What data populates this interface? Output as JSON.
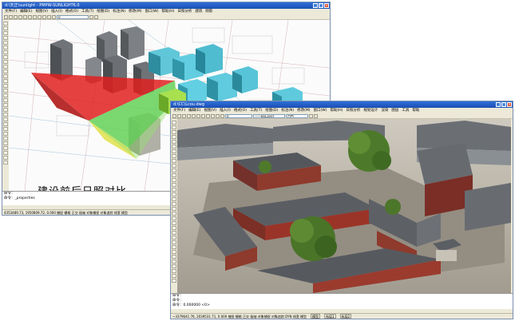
{
  "window_a": {
    "title": "d:\\天正\\sunlight - PMPW-SUNLIGHT6.0",
    "menu": [
      "文件(F)",
      "编辑(E)",
      "视图(V)",
      "插入(I)",
      "格式(O)",
      "工具(T)",
      "绘图(D)",
      "标注(N)",
      "修改(M)",
      "窗口(W)",
      "帮助(H)",
      "日照分析",
      "建筑",
      "阴影"
    ],
    "layer_combo": "0",
    "caption": "建设前后日照对比",
    "command_lines": [
      "命令：",
      "命令：_properties",
      "已保存到 C:\\Documents and Settings\\...\\sun.bmp"
    ],
    "status_text": "4353489.73, 1950809.72, 0.000   捕捉 栅格 正交 极轴 对象捕捉 对象追踪 线宽 模型"
  },
  "window_b": {
    "title": "d:\\CC\\Lcou.dwg",
    "menu": [
      "文件(F)",
      "编辑(E)",
      "视图(V)",
      "插入(I)",
      "格式(O)",
      "工具(T)",
      "绘图(D)",
      "标注(N)",
      "修改(M)",
      "窗口(W)",
      "帮助(H)",
      "日照分析",
      "规划设计",
      "渲染",
      "图层",
      "工具",
      "帮助"
    ],
    "layer_combo": "0",
    "linetype_combo": "——ByLayer",
    "color_combo": "白色",
    "command_lines": [
      "命令：",
      "命令：",
      "命令：0.000000 <0>"
    ],
    "status_text": "~3379641.76, 2039531.71, 0.000   捕捉 栅格 正交 极轴 对象捕捉 对象追踪 DYN 线宽 模型",
    "status_buttons": [
      "模型",
      "布局1",
      "布局2"
    ]
  },
  "colors": {
    "title_blue": "#1f5cc8",
    "sun_red": "#e02020",
    "sun_green": "#40c040",
    "sun_yellow": "#f0e060",
    "building_cyan": "#5fd0e0",
    "roof_gray": "#5d6268",
    "wall_red": "#9a3428",
    "tree_green": "#4f7a2c"
  }
}
